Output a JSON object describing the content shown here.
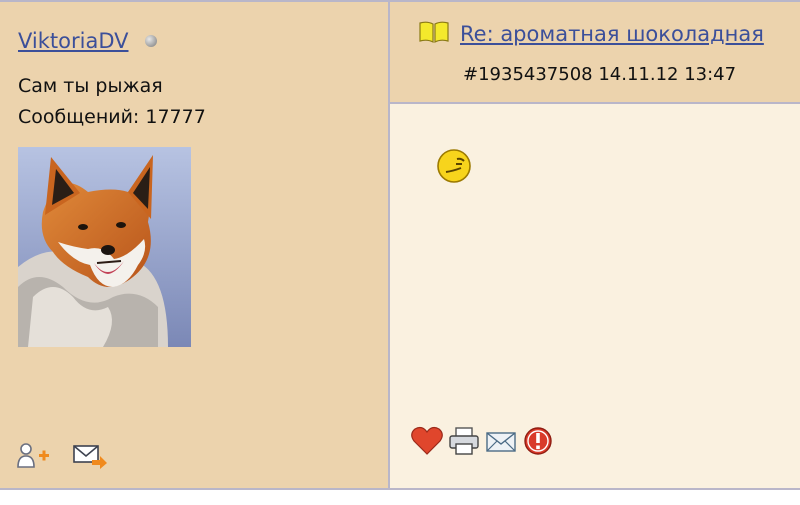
{
  "user": {
    "name": "ViktoriaDV",
    "status_text": "Сам ты рыжая",
    "posts_label": "Сообщений:",
    "posts_count": "17777",
    "posts_line": "Сообщений: 17777"
  },
  "post": {
    "title": "Re: ароматная шоколадная",
    "meta": "#1935437508 14.11.12 13:47"
  },
  "icons": {
    "status": "offline-status-icon",
    "topic": "open-book-icon",
    "smiley": "smiley-icon",
    "sidebar_actions": [
      "add-friend-icon",
      "send-message-icon"
    ],
    "post_actions": [
      "like-heart-icon",
      "print-icon",
      "email-icon",
      "report-icon"
    ]
  },
  "colors": {
    "sidebar_bg": "#ecd3ad",
    "content_bg": "#faf1e0",
    "link": "#3b4f9a",
    "border": "#b9b6c9"
  }
}
